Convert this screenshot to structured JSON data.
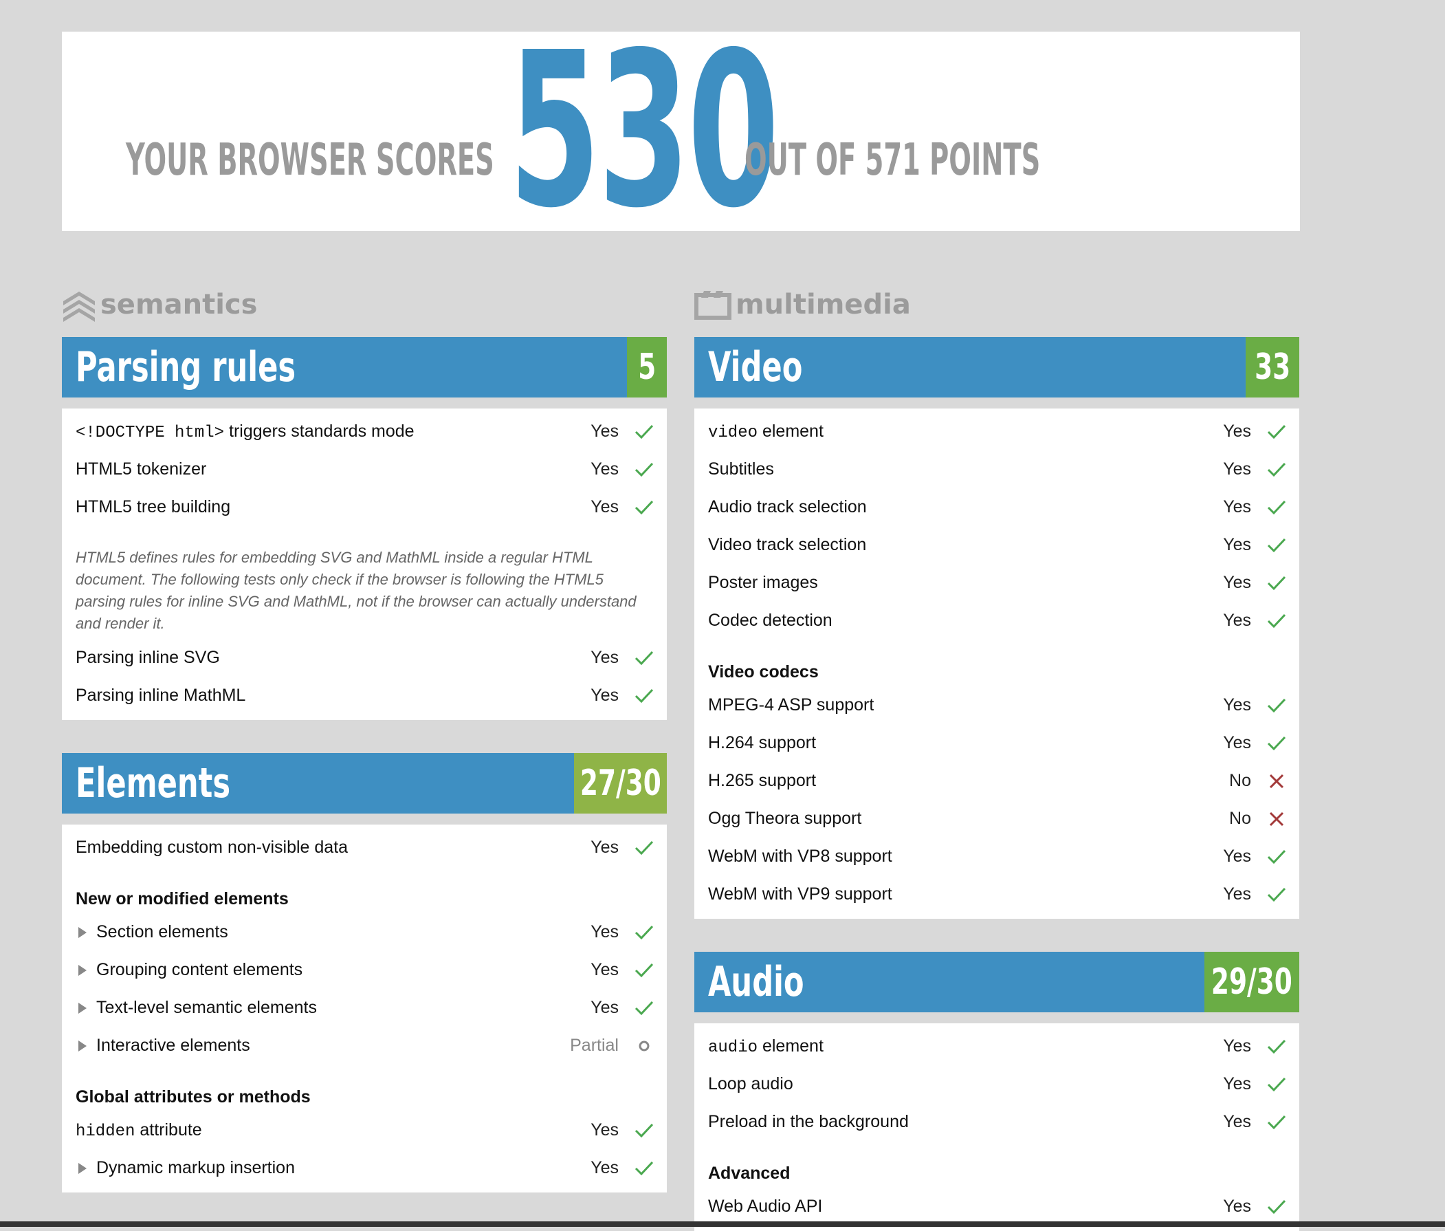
{
  "score": {
    "prefix": "YOUR BROWSER SCORES",
    "value": "530",
    "suffix": "OUT OF 571 POINTS"
  },
  "colors": {
    "accent_blue": "#3e8fc2",
    "score_green": "#6aad45",
    "score_olive": "#8fb447",
    "yes_green": "#4aa84f",
    "no_red": "#a33a3a",
    "muted": "#9b9b9b"
  },
  "categories": {
    "semantics": "semantics",
    "multimedia": "multimedia"
  },
  "parsing": {
    "title": "Parsing rules",
    "score": "5",
    "rows": [
      {
        "label_code": "<!DOCTYPE html>",
        "label": " triggers standards mode",
        "result": "Yes"
      },
      {
        "label": "HTML5 tokenizer",
        "result": "Yes"
      },
      {
        "label": "HTML5 tree building",
        "result": "Yes"
      }
    ],
    "note": "HTML5 defines rules for embedding SVG and MathML inside a regular HTML document. The following tests only check if the browser is following the HTML5 parsing rules for inline SVG and MathML, not if the browser can actually understand and render it.",
    "rows2": [
      {
        "label": "Parsing inline SVG",
        "result": "Yes"
      },
      {
        "label": "Parsing inline MathML",
        "result": "Yes"
      }
    ]
  },
  "elements": {
    "title": "Elements",
    "score": "27/30",
    "row_embed": {
      "label": "Embedding custom non-visible data",
      "result": "Yes"
    },
    "subhead_new": "New or modified elements",
    "new_rows": [
      {
        "label": "Section elements",
        "result": "Yes"
      },
      {
        "label": "Grouping content elements",
        "result": "Yes"
      },
      {
        "label": "Text-level semantic elements",
        "result": "Yes"
      },
      {
        "label": "Interactive elements",
        "result": "Partial"
      }
    ],
    "subhead_global": "Global attributes or methods",
    "global_rows": [
      {
        "label_code": "hidden",
        "label": " attribute",
        "result": "Yes"
      },
      {
        "label": "Dynamic markup insertion",
        "result": "Yes"
      }
    ]
  },
  "video": {
    "title": "Video",
    "score": "33",
    "rows": [
      {
        "label_code": "video",
        "label": " element",
        "result": "Yes"
      },
      {
        "label": "Subtitles",
        "result": "Yes"
      },
      {
        "label": "Audio track selection",
        "result": "Yes"
      },
      {
        "label": "Video track selection",
        "result": "Yes"
      },
      {
        "label": "Poster images",
        "result": "Yes"
      },
      {
        "label": "Codec detection",
        "result": "Yes"
      }
    ],
    "subhead_codecs": "Video codecs",
    "codec_rows": [
      {
        "label": "MPEG-4 ASP support",
        "result": "Yes"
      },
      {
        "label": "H.264 support",
        "result": "Yes"
      },
      {
        "label": "H.265 support",
        "result": "No"
      },
      {
        "label": "Ogg Theora support",
        "result": "No"
      },
      {
        "label": "WebM with VP8 support",
        "result": "Yes"
      },
      {
        "label": "WebM with VP9 support",
        "result": "Yes"
      }
    ]
  },
  "audio": {
    "title": "Audio",
    "score": "29/30",
    "rows": [
      {
        "label_code": "audio",
        "label": " element",
        "result": "Yes"
      },
      {
        "label": "Loop audio",
        "result": "Yes"
      },
      {
        "label": "Preload in the background",
        "result": "Yes"
      }
    ],
    "subhead_advanced": "Advanced",
    "adv_rows": [
      {
        "label": "Web Audio API",
        "result": "Yes"
      }
    ]
  }
}
